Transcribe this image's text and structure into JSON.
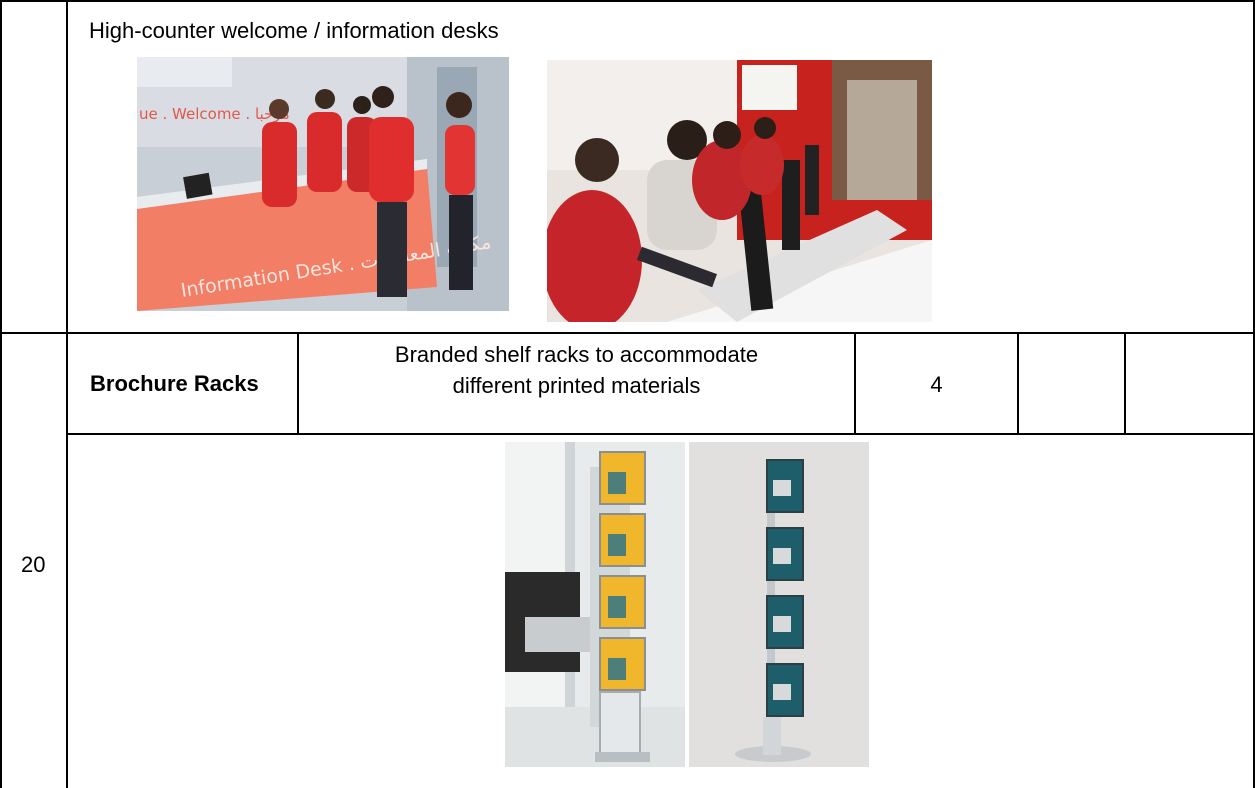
{
  "section1": {
    "caption": "High-counter welcome / information desks",
    "photo1": {
      "desk_text": "Information Desk . مكتب المعلومات",
      "wall_text": "ue . Welcome . مرحبا"
    }
  },
  "row20": {
    "number": "20",
    "item": "Brochure Racks",
    "description_line1": "Branded shelf racks to accommodate",
    "description_line2": "different printed materials",
    "quantity": "4",
    "col5": "",
    "col6": ""
  }
}
